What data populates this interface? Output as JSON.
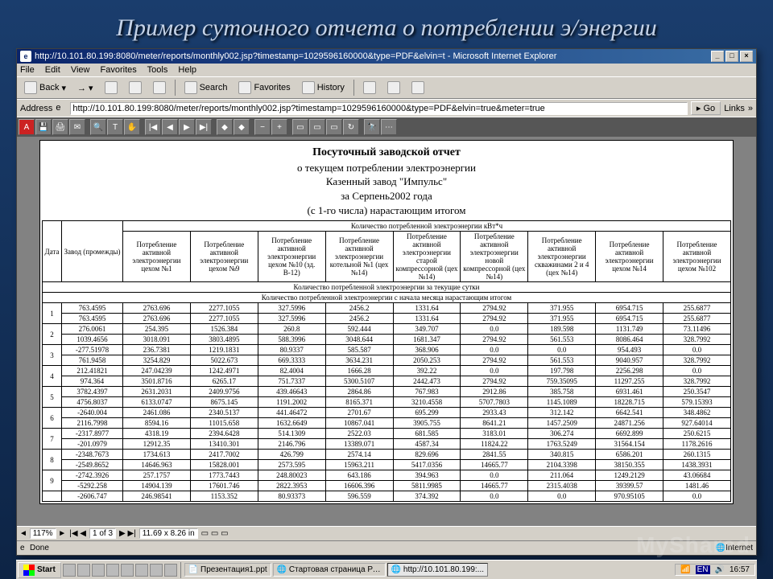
{
  "slide": {
    "title": "Пример суточного отчета о потреблении э/энергии"
  },
  "window": {
    "title": "http://10.101.80.199:8080/meter/reports/monthly002.jsp?timestamp=1029596160000&type=PDF&elvin=t - Microsoft Internet Explorer"
  },
  "menus": [
    "File",
    "Edit",
    "View",
    "Favorites",
    "Tools",
    "Help"
  ],
  "toolbar": {
    "back": "Back",
    "search": "Search",
    "favorites": "Favorites",
    "history": "History"
  },
  "address": {
    "label": "Address",
    "value": "http://10.101.80.199:8080/meter/reports/monthly002.jsp?timestamp=1029596160000&type=PDF&elvin=true&meter=true",
    "go": "Go",
    "links": "Links"
  },
  "acrobat_pagebox": "1 of 3",
  "acrobat_zoom": "117%",
  "acrobat_size": "11.69 x 8.26 in",
  "report": {
    "title1": "Посуточный заводской отчет",
    "title2": "о текущем потреблении электроэнергии",
    "title3": "Казенный завод \"Импульс\"",
    "title4": "за Серпень2002 года",
    "title5": "(с 1-го числа) нарастающим итогом",
    "super_header": "Количество потребленной электроэнергии кВт*ч",
    "col_date": "Дата",
    "col_zavod": "Завод (промежды)",
    "cols": [
      "Потребление активной электроэнергии цехом №1",
      "Потребление активной электроэнергии цехом №9",
      "Потребление активной электроэнергии цехом №10 (зд. В-12)",
      "Потребление активной электроэнергии котельной №1 (цех №14)",
      "Потребление активной электроэнергии старой компрессорной (цех №14)",
      "Потребление активной электроэнергии новой компрессорной (цех №14)",
      "Потребление активной электроэнергии скважинами 2 и 4 (цех №14)",
      "Потребление активной электроэнергии цехом №14",
      "Потребление активной электроэнергии цехом №102"
    ],
    "span1": "Количество потребленной электроэнергии за текущие сутки",
    "span2": "Количество потребленной электроэнергии с начала месяца нарастающим итогом",
    "rows": [
      {
        "n": "1",
        "a": [
          "763.4595",
          "2763.696",
          "2277.1055",
          "327.5996",
          "2456.2",
          "1331.64",
          "2794.92",
          "371.955",
          "6954.715",
          "255.6877"
        ],
        "b": [
          "763.4595",
          "2763.696",
          "2277.1055",
          "327.5996",
          "2456.2",
          "1331.64",
          "2794.92",
          "371.955",
          "6954.715",
          "255.6877"
        ]
      },
      {
        "n": "2",
        "a": [
          "276.0061",
          "254.395",
          "1526.384",
          "260.8",
          "592.444",
          "349.707",
          "0.0",
          "189.598",
          "1131.749",
          "73.11496"
        ],
        "b": [
          "1039.4656",
          "3018.091",
          "3803.4895",
          "588.3996",
          "3048.644",
          "1681.347",
          "2794.92",
          "561.553",
          "8086.464",
          "328.7992"
        ]
      },
      {
        "n": "3",
        "a": [
          "-277.51978",
          "236.7381",
          "1219.1831",
          "80.9337",
          "585.587",
          "368.906",
          "0.0",
          "0.0",
          "954.493",
          "0.0"
        ],
        "b": [
          "761.9458",
          "3254.829",
          "5022.673",
          "669.3333",
          "3634.231",
          "2050.253",
          "2794.92",
          "561.553",
          "9040.957",
          "328.7992"
        ]
      },
      {
        "n": "4",
        "a": [
          "212.41821",
          "247.04239",
          "1242.4971",
          "82.4004",
          "1666.28",
          "392.22",
          "0.0",
          "197.798",
          "2256.298",
          "0.0"
        ],
        "b": [
          "974.364",
          "3501.8716",
          "6265.17",
          "751.7337",
          "5300.5107",
          "2442.473",
          "2794.92",
          "759.35095",
          "11297.255",
          "328.7992"
        ]
      },
      {
        "n": "5",
        "a": [
          "3782.4397",
          "2631.2031",
          "2409.9756",
          "439.46643",
          "2864.86",
          "767.983",
          "2912.86",
          "385.758",
          "6931.461",
          "250.3547"
        ],
        "b": [
          "4756.8037",
          "6133.0747",
          "8675.145",
          "1191.2002",
          "8165.371",
          "3210.4558",
          "5707.7803",
          "1145.1089",
          "18228.715",
          "579.15393"
        ]
      },
      {
        "n": "6",
        "a": [
          "-2640.004",
          "2461.086",
          "2340.5137",
          "441.46472",
          "2701.67",
          "695.299",
          "2933.43",
          "312.142",
          "6642.541",
          "348.4862"
        ],
        "b": [
          "2116.7998",
          "8594.16",
          "11015.658",
          "1632.6649",
          "10867.041",
          "3905.755",
          "8641.21",
          "1457.2509",
          "24871.256",
          "927.64014"
        ]
      },
      {
        "n": "7",
        "a": [
          "-2317.8977",
          "4318.19",
          "2394.6428",
          "514.1309",
          "2522.03",
          "681.585",
          "3183.01",
          "306.274",
          "6692.899",
          "250.6215"
        ],
        "b": [
          "-201.0979",
          "12912.35",
          "13410.301",
          "2146.796",
          "13389.071",
          "4587.34",
          "11824.22",
          "1763.5249",
          "31564.154",
          "1178.2616"
        ]
      },
      {
        "n": "8",
        "a": [
          "-2348.7673",
          "1734.613",
          "2417.7002",
          "426.799",
          "2574.14",
          "829.696",
          "2841.55",
          "340.815",
          "6586.201",
          "260.1315"
        ],
        "b": [
          "-2549.8652",
          "14646.963",
          "15828.001",
          "2573.595",
          "15963.211",
          "5417.0356",
          "14665.77",
          "2104.3398",
          "38150.355",
          "1438.3931"
        ]
      },
      {
        "n": "9",
        "a": [
          "-2742.3926",
          "257.1757",
          "1773.7443",
          "248.80023",
          "643.186",
          "394.963",
          "0.0",
          "211.064",
          "1249.2129",
          "43.06684"
        ],
        "b": [
          "-5292.258",
          "14904.139",
          "17601.746",
          "2822.3953",
          "16606.396",
          "5811.9985",
          "14665.77",
          "2315.4038",
          "39399.57",
          "1481.46"
        ]
      },
      {
        "n": "",
        "a": [
          "-2606.747",
          "246.98541",
          "1153.352",
          "80.93373",
          "596.559",
          "374.392",
          "0.0",
          "0.0",
          "970.95105",
          "0.0"
        ],
        "b": null
      }
    ]
  },
  "status": {
    "done": "Done",
    "zone": "Internet"
  },
  "taskbar": {
    "start": "Start",
    "tasks": [
      "Презентация1.ppt",
      "Стартовая страница Ре...",
      "http://10.101.80.199:..."
    ],
    "lang": "EN",
    "time": "16:57"
  },
  "watermark": "MyShared"
}
